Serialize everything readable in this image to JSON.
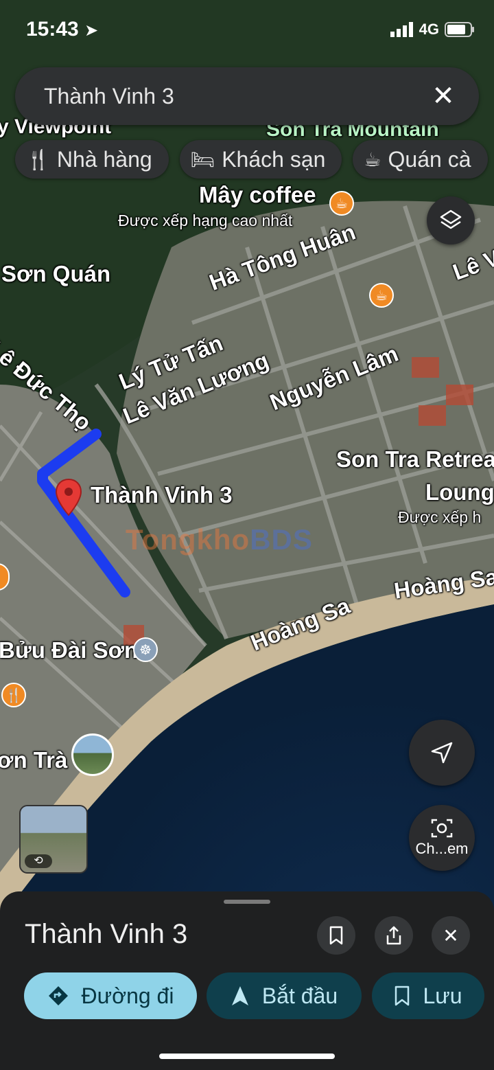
{
  "status_bar": {
    "time": "15:43",
    "network": "4G"
  },
  "search": {
    "query": "Thành Vinh 3"
  },
  "chips": [
    {
      "icon": "restaurant-icon",
      "label": "Nhà hàng"
    },
    {
      "icon": "hotel-icon",
      "label": "Khách sạn"
    },
    {
      "icon": "cafe-icon",
      "label": "Quán cà"
    }
  ],
  "map": {
    "labels": {
      "viewpoint": "y Viewpoint",
      "son_tra_mountain": "Son Tra Mountain",
      "may_coffee": "Mây coffee",
      "top_rated": "Được xếp hạng cao nhất",
      "son_quan": "Sơn Quán",
      "ha_tong_huan": "Hà Tông Huân",
      "le_va": "Lê Va",
      "le_duc_tho": "Lê Đức Thọ",
      "ly_tu_tan": "Lý Tử Tấn",
      "le_van_luong": "Lê Văn Lương",
      "nguyen_lam": "Nguyễn Lâm",
      "son_tra_retreat": "Son Tra Retreat",
      "lounge": "Lounge",
      "top_rated_short": "Được xếp h",
      "pin_label": "Thành Vinh 3",
      "hoang_sa_1": "Hoàng Sa",
      "hoang_sa_2": "Hoàng Sa",
      "buu_dai_son": "Bửu Đài Sơn",
      "son_tra": "ơn Trà"
    },
    "watermark_a": "Tongkho",
    "watermark_b": "BDS"
  },
  "controls": {
    "street_view_label": "Ch...em"
  },
  "sheet": {
    "title": "Thành Vinh 3",
    "actions": {
      "directions": "Đường đi",
      "start": "Bắt đầu",
      "save": "Lưu"
    }
  }
}
